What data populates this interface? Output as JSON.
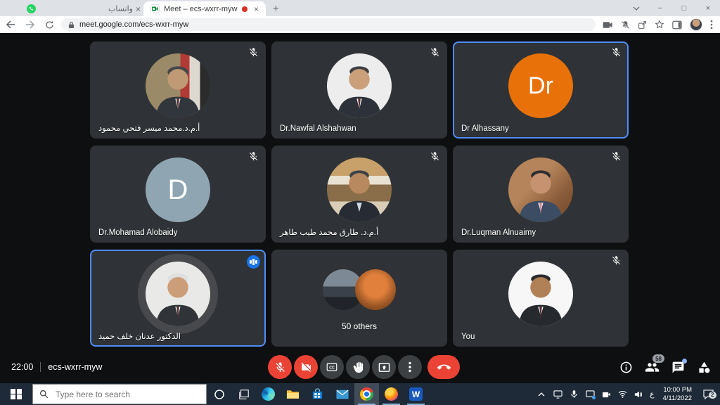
{
  "browser": {
    "tabs": [
      {
        "title": "واتساب",
        "icon": "whatsapp-icon"
      },
      {
        "title": "Meet – ecs-wxrr-myw",
        "icon": "meet-icon",
        "recording": true
      }
    ],
    "url": "meet.google.com/ecs-wxrr-myw"
  },
  "icons": {
    "close": "×",
    "new_tab": "+",
    "minimize": "−",
    "maximize": "□",
    "word": "W"
  },
  "meet": {
    "participants": [
      {
        "name": "أ.م.د.محمد ميسر فتحي محمود",
        "muted": true
      },
      {
        "name": "Dr.Nawfal Alshahwan",
        "muted": true
      },
      {
        "name": "Dr Alhassany",
        "muted": true,
        "avatar_text": "Dr",
        "highlighted": true
      },
      {
        "name": "Dr.Mohamad Alobaidy",
        "muted": true,
        "avatar_text": "D"
      },
      {
        "name": "أ.م.د. طارق محمد طيب طاهر",
        "muted": true
      },
      {
        "name": "Dr.Luqman Alnuaimy",
        "muted": true
      },
      {
        "name": "الدكتور عدنان خلف حميد",
        "muted": false,
        "speaking": true
      },
      {
        "name": "50 others",
        "overflow": true
      },
      {
        "name": "You",
        "muted": true
      }
    ],
    "footer": {
      "time": "22:00",
      "code": "ecs-wxrr-myw"
    },
    "controls": {
      "cc_label": "CC"
    },
    "people_count": "58"
  },
  "taskbar": {
    "search_placeholder": "Type here to search",
    "clock_time": "10:00 PM",
    "clock_date": "4/11/2022",
    "language": "ع",
    "notification_count": "2"
  },
  "colors": {
    "accent_blue": "#4e8df6",
    "control_red": "#ea4335",
    "avatar_orange": "#e8710a",
    "avatar_bluegrey": "#8fa5b2",
    "speaking_indicator": "#1a73e8"
  }
}
